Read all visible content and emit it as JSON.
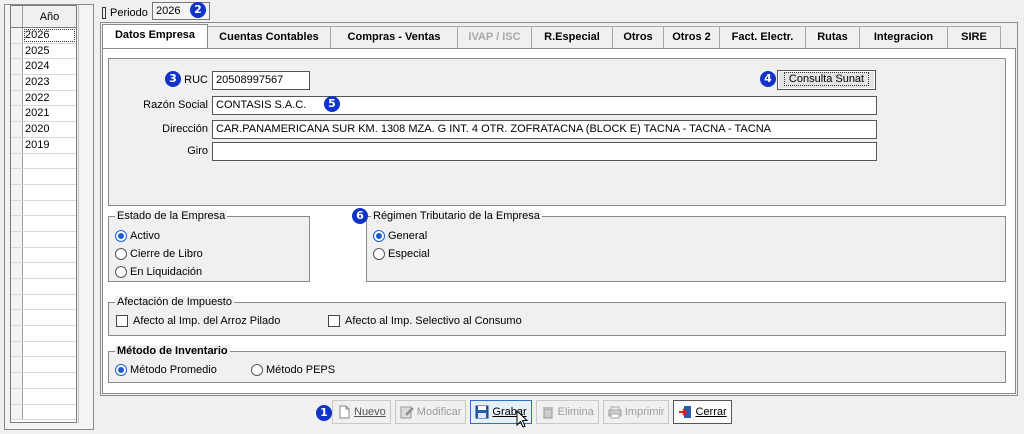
{
  "year_list": {
    "header": "Año",
    "years": [
      "2026",
      "2025",
      "2024",
      "2023",
      "2022",
      "2021",
      "2020",
      "2019"
    ]
  },
  "periodo": {
    "label": "Periodo",
    "value": "2026"
  },
  "tabs": [
    {
      "label": "Datos Empresa",
      "state": "active"
    },
    {
      "label": "Cuentas Contables",
      "state": "normal"
    },
    {
      "label": "Compras - Ventas",
      "state": "normal"
    },
    {
      "label": "IVAP / ISC",
      "state": "disabled"
    },
    {
      "label": "R.Especial",
      "state": "normal"
    },
    {
      "label": "Otros",
      "state": "normal"
    },
    {
      "label": "Otros 2",
      "state": "normal"
    },
    {
      "label": "Fact. Electr.",
      "state": "normal"
    },
    {
      "label": "Rutas",
      "state": "normal"
    },
    {
      "label": "Integracion",
      "state": "normal"
    },
    {
      "label": "SIRE",
      "state": "normal"
    }
  ],
  "company": {
    "ruc_label": "RUC",
    "ruc_value": "20508997567",
    "razon_label": "Razón Social",
    "razon_value": "CONTASIS S.A.C.",
    "direccion_label": "Dirección",
    "direccion_value": "CAR.PANAMERICANA SUR KM. 1308 MZA. G INT. 4 OTR.  ZOFRATACNA  (BLOCK E) TACNA - TACNA - TACNA",
    "giro_label": "Giro",
    "giro_value": "",
    "consulta_button": "Consulta Sunat"
  },
  "estado": {
    "title": "Estado de la Empresa",
    "options": [
      {
        "label": "Activo",
        "checked": true
      },
      {
        "label": "Cierre de Libro",
        "checked": false
      },
      {
        "label": "En Liquidación",
        "checked": false
      }
    ]
  },
  "regimen": {
    "title": "Régimen Tributario de la Empresa",
    "options": [
      {
        "label": "General",
        "checked": true
      },
      {
        "label": "Especial",
        "checked": false
      }
    ]
  },
  "afectacion": {
    "title": "Afectación de  Impuesto",
    "options": [
      {
        "label": "Afecto al Imp. del Arroz Pilado",
        "checked": false
      },
      {
        "label": "Afecto al Imp. Selectivo al Consumo",
        "checked": false
      }
    ]
  },
  "inventario": {
    "title": "Método de Inventario",
    "options": [
      {
        "label": "Método Promedio",
        "checked": true
      },
      {
        "label": "Método PEPS",
        "checked": false
      }
    ]
  },
  "toolbar": {
    "nuevo": "Nuevo",
    "modificar": "Modificar",
    "grabar": "Grabar",
    "elimina": "Elimina",
    "imprimir": "Imprimir",
    "cerrar": "Cerrar"
  },
  "badges": [
    "1",
    "2",
    "3",
    "4",
    "5",
    "6"
  ],
  "colors": {
    "badge": "#1232c8",
    "radio_selected": "#1a5fd0",
    "window_bg": "#f0f0f0",
    "disabled_text": "#a8a8a8"
  }
}
